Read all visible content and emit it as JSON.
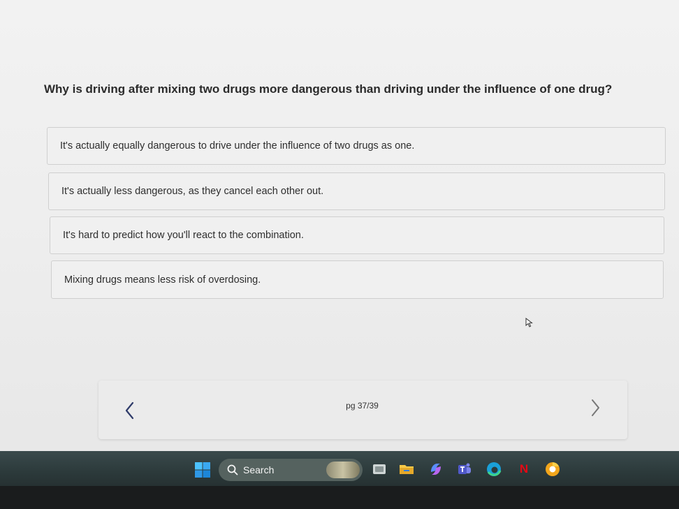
{
  "question": "Why is driving after mixing two drugs more dangerous than driving under the influence of one drug?",
  "options": [
    "It's actually equally dangerous to drive under the influence of two drugs as one.",
    "It's actually less dangerous, as they cancel each other out.",
    "It's hard to predict how you'll react to the combination.",
    "Mixing drugs means less risk of overdosing."
  ],
  "pager": {
    "page_label": "pg 37/39",
    "prev_icon": "chevron-left-icon",
    "next_icon": "chevron-right-icon"
  },
  "taskbar": {
    "search_label": "Search",
    "icons": [
      "windows-start-icon",
      "search-icon",
      "task-view-icon",
      "file-explorer-icon",
      "copilot-icon",
      "teams-icon",
      "edge-icon",
      "netflix-icon",
      "chrome-canary-icon"
    ],
    "netflix_letter": "N"
  },
  "colors": {
    "taskbar": "#2c3a3b",
    "netflix": "#e50914",
    "edge": "#1aa0d8",
    "accent": "#2b2b2b"
  }
}
